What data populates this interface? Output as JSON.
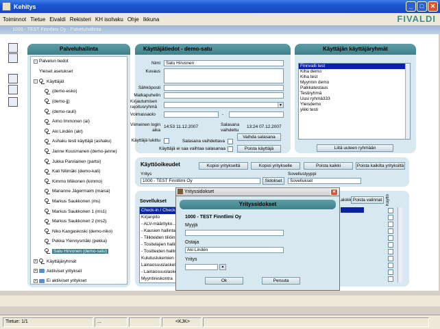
{
  "window": {
    "title": "Kehitys",
    "min": "_",
    "max": "□",
    "close": "✕"
  },
  "menu": [
    "Toiminnot",
    "Tietue",
    "Eivaldi",
    "Rekisteri",
    "KH isohaku",
    "Ohje",
    "Ikkuna"
  ],
  "brand": "FIVALDI",
  "mdi_title": "1000 - TEST Finntlimi Oy - Palveluhallinta",
  "tree": {
    "header": "Palveluhallinta",
    "items": [
      {
        "label": "Palvelun tiedot",
        "indent": 0,
        "expand": "−"
      },
      {
        "label": "Yleiset asetukset",
        "indent": 1
      },
      {
        "label": "Käyttäjät",
        "indent": 0,
        "expand": "−",
        "key": true
      },
      {
        "label": "(demo-esko)",
        "indent": 2,
        "key": true
      },
      {
        "label": "(demo-jj)",
        "indent": 2,
        "key": true
      },
      {
        "label": "(demo-rauli)",
        "indent": 2,
        "key": true
      },
      {
        "label": "Aimo Immonen (ai)",
        "indent": 2,
        "key": true
      },
      {
        "label": "Aki Lindén (akl)",
        "indent": 2,
        "key": true
      },
      {
        "label": "Ashaku testi käyttäjä (ashaku)",
        "indent": 2,
        "key": true
      },
      {
        "label": "Janne Kuusmanen (demo-janne)",
        "indent": 2,
        "key": true
      },
      {
        "label": "Jukka Parviainen (partsi)",
        "indent": 2,
        "key": true
      },
      {
        "label": "Kati Nilimäki (demo-kati)",
        "indent": 2,
        "key": true
      },
      {
        "label": "Kimmo Miikonen (kimmo)",
        "indent": 2,
        "key": true
      },
      {
        "label": "Marianne Jägermalm (maisa)",
        "indent": 2,
        "key": true
      },
      {
        "label": "Markus Saukkonen (ms)",
        "indent": 2,
        "key": true
      },
      {
        "label": "Markus Saukkonen 1 (ms1)",
        "indent": 2,
        "key": true
      },
      {
        "label": "Markus Saukkonen 2 (ms2)",
        "indent": 2,
        "key": true
      },
      {
        "label": "Niko Kangaskoski (demo-niko)",
        "indent": 2,
        "key": true
      },
      {
        "label": "Pekka Ylennysmäki (pekka)",
        "indent": 2,
        "key": true
      },
      {
        "label": "Satu Hirvonen (demo-satu)",
        "indent": 2,
        "key": true,
        "selected": true
      },
      {
        "label": "Käyttäjäryhmät",
        "indent": 0,
        "expand": "+",
        "key": true
      },
      {
        "label": "Aktiiviset yritykset",
        "indent": 0,
        "expand": "+",
        "folder": true
      },
      {
        "label": "Ei aktiiviset yritykset",
        "indent": 0,
        "expand": "+",
        "folder": true
      }
    ]
  },
  "userinfo": {
    "header": "Käyttäjätiedot - demo-satu",
    "labels": {
      "nimi": "Nimi",
      "kuvaus": "Kuvaus",
      "email": "Sähköposti",
      "phone": "Matkapuhelin",
      "restrict": "Kirjautumisen rajoitusryhmä",
      "valid": "Voimassaolo",
      "last_login": "Viimeinen login aika",
      "pw_changed": "Salasana vaihdettu",
      "locked": "Käyttäjä lukittu",
      "must_change": "Salasana vaihdettava",
      "cannot_change": "Käyttäjä ei saa vaihtaa salasanaa"
    },
    "values": {
      "nimi": "Satu Hirvonen",
      "valid_sep": "-",
      "last_login": "14:53 11.12.2007",
      "pw_changed": "13:24 07.12.2007"
    },
    "buttons": {
      "change_pw": "Vaihda salasana",
      "delete": "Poista käyttäjä"
    }
  },
  "groups": {
    "header": "Käyttäjän käyttäjäryhmät",
    "items": [
      "Finnvalli test",
      "Kiha demo",
      "Kiha test",
      "Myynnin demo",
      "Palkkatestaus",
      "Testiryhmä",
      "Uusi ryhmä333",
      "Yleisdemo",
      "yliiki testi"
    ],
    "selected": 0,
    "button": "Liitä uuteen ryhmään"
  },
  "rights": {
    "header": "Käyttöoikeudet",
    "buttons": [
      "Kopioi yritykseltä",
      "Kopioi yritykselle",
      "Poista kaikki",
      "Poista kaikilta yrityksiltä"
    ],
    "company_label": "Yritys",
    "company_value": "1000 - TEST Finntlimi Oy",
    "sidokset": "Sidokset",
    "apptype_label": "Sovellustyyppi",
    "apptype_value": "Sovellukset",
    "apps_header": "Sovellukset",
    "apps": [
      "Check-in / Check-out",
      "Kirjanpito",
      "- ALV-määrityko...",
      "- Kausien hallinta",
      "- Tilikteiden tiliöinnit",
      "- Tositelajien hallinta",
      "- Tositteiden hallinta",
      "Kulutuslukemien syöttö",
      "Lainaosuuslaskelma",
      "- Lainaosuuslaskelma",
      "Myyntireskontra"
    ],
    "col_extra": "...alokkaic",
    "col_remove": "Poista valinnat",
    "col_kaytto": "Käyttö"
  },
  "dialog": {
    "title": "Yrityssidokset",
    "header": "Yrityssidokset",
    "company": "1000 - TEST Finntlimi Oy",
    "seller_label": "Myyjä",
    "seller_value": "",
    "buyer_label": "Ostaja",
    "buyer_value": "Aki Lindén",
    "company_label": "Yritys",
    "company_value": "",
    "ok": "Ok",
    "cancel": "Peruuta"
  },
  "statusbar": {
    "record": "Tietue: 1/1",
    "dots": "...",
    "mode": "<KJK>"
  }
}
